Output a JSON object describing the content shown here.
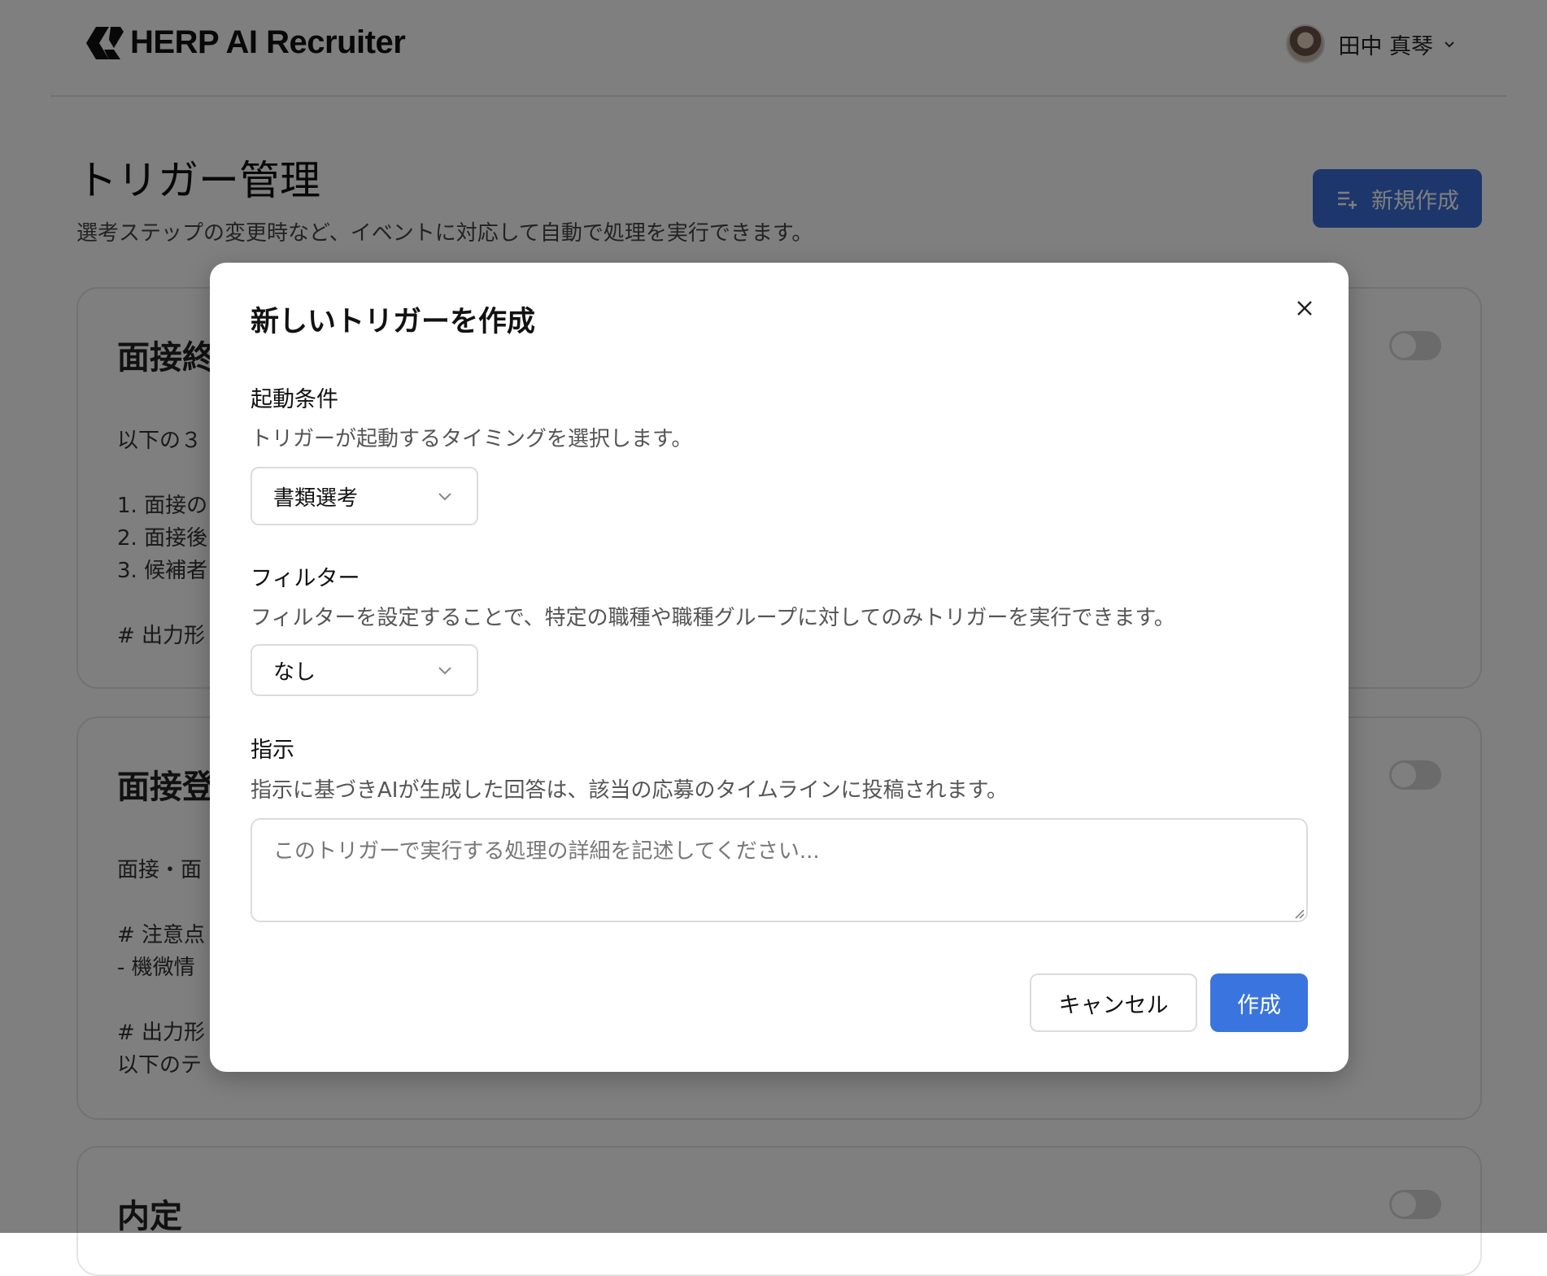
{
  "header": {
    "logo_text": "HERP AI Recruiter",
    "user_name": "田中 真琴"
  },
  "page": {
    "title": "トリガー管理",
    "subtitle": "選考ステップの変更時など、イベントに対応して自動で処理を実行できます。",
    "new_button_label": "新規作成"
  },
  "cards": [
    {
      "title": "面接終",
      "lines": [
        "以下の３",
        "1. 面接の",
        "2. 面接後",
        "3. 候補者",
        "# 出力形"
      ]
    },
    {
      "title": "面接登",
      "lines": [
        "面接・面",
        "# 注意点",
        "- 機微情",
        "# 出力形",
        "以下のテ"
      ]
    },
    {
      "title": "内定",
      "lines": []
    }
  ],
  "modal": {
    "title": "新しいトリガーを作成",
    "trigger": {
      "label": "起動条件",
      "help": "トリガーが起動するタイミングを選択します。",
      "value": "書類選考"
    },
    "filter": {
      "label": "フィルター",
      "help": "フィルターを設定することで、特定の職種や職種グループに対してのみトリガーを実行できます。",
      "value": "なし"
    },
    "instruction": {
      "label": "指示",
      "help": "指示に基づきAIが生成した回答は、該当の応募のタイムラインに投稿されます。",
      "value": "",
      "placeholder": "このトリガーで実行する処理の詳細を記述してください..."
    },
    "cancel_label": "キャンセル",
    "create_label": "作成"
  },
  "colors": {
    "primary": "#3a74de",
    "overlay": "rgba(0,0,0,0.5)"
  }
}
